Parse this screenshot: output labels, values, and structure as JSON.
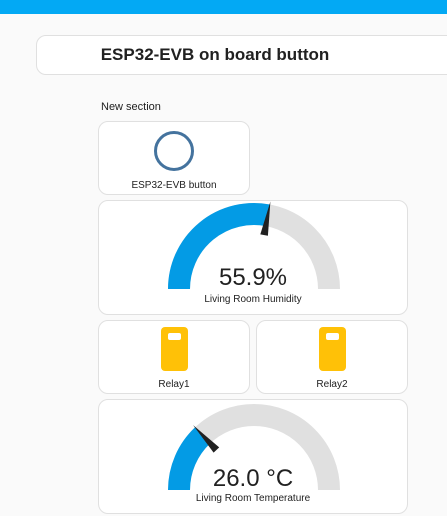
{
  "header": {
    "title": "ESP32-EVB on board button"
  },
  "section": {
    "label": "New section"
  },
  "button_card": {
    "name": "ESP32-EVB button",
    "icon": "ring-icon",
    "icon_color": "#44739e"
  },
  "humidity": {
    "value": 55.9,
    "display": "55.9%",
    "name": "Living Room Humidity",
    "min": 0,
    "max": 100
  },
  "relays": [
    {
      "name": "Relay1",
      "icon": "relay-icon",
      "color": "#ffc107"
    },
    {
      "name": "Relay2",
      "icon": "relay-icon",
      "color": "#ffc107"
    }
  ],
  "temperature": {
    "value": 26.0,
    "display": "26.0 °C",
    "name": "Living Room Temperature",
    "min": 0,
    "max": 100
  },
  "colors": {
    "accent": "#03a9f4",
    "gauge": "#039be5",
    "needle": "#212121"
  }
}
